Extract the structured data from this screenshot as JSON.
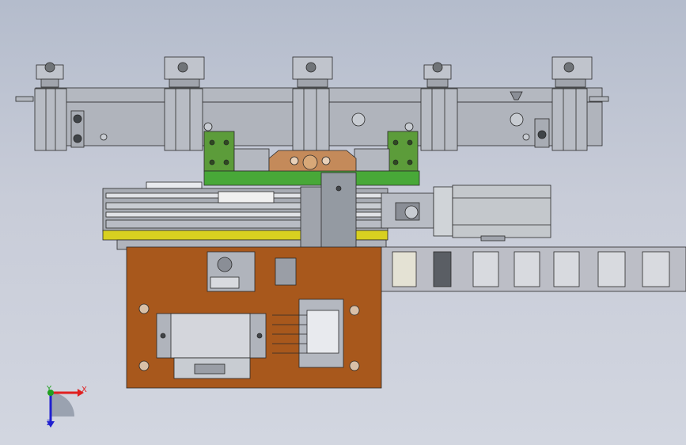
{
  "view": {
    "type": "cad-3d-viewport",
    "background_top": "#b4bccc",
    "background_bottom": "#d2d6e0"
  },
  "colors": {
    "metal": "#b4b8c0",
    "metal_dark": "#8a8e96",
    "edge": "#2a2a2a",
    "base_plate": "#a8581c",
    "copper": "#c48a5a",
    "green_block": "#5c9c3a",
    "green_rail": "#48a838",
    "yellow_rail": "#d8d020",
    "motor": "#c4c8cc",
    "cable_chain": "#bcbec6",
    "axis_x": "#e02020",
    "axis_y": "#20a020",
    "axis_z": "#2020d0"
  },
  "triad": {
    "x_label": "X",
    "y_label": "Y",
    "z_label": "Z",
    "icons": [
      "axis-x-icon",
      "axis-y-icon",
      "axis-z-icon"
    ]
  }
}
